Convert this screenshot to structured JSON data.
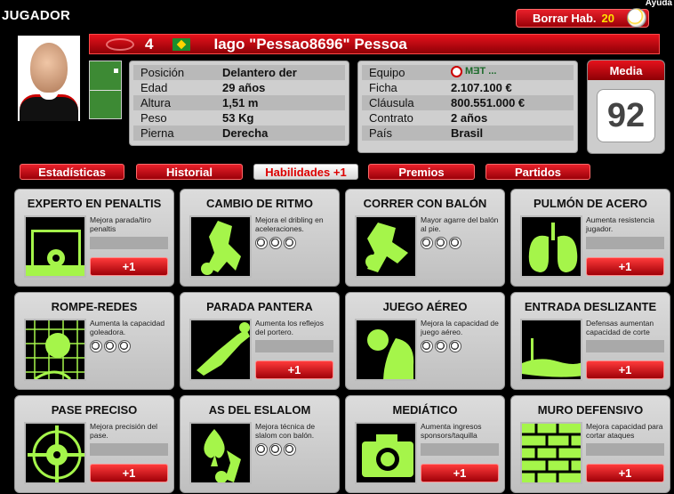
{
  "header": {
    "title": "JUGADOR",
    "help": "Ayuda",
    "borrar_label": "Borrar Hab.",
    "borrar_count": "20"
  },
  "player": {
    "number": "4",
    "name": "Iago \"Pessao8696\" Pessoa",
    "flag": "brazil-flag-icon"
  },
  "info_left": [
    {
      "label": "Posición",
      "value": "Delantero der"
    },
    {
      "label": "Edad",
      "value": "29 años"
    },
    {
      "label": "Altura",
      "value": "1,51 m"
    },
    {
      "label": "Peso",
      "value": "53 Kg"
    },
    {
      "label": "Pierna",
      "value": "Derecha"
    }
  ],
  "info_right": [
    {
      "label": "Equipo",
      "value": "MƎT ..."
    },
    {
      "label": "Ficha",
      "value": "2.107.100 €"
    },
    {
      "label": "Cláusula",
      "value": "800.551.000 €"
    },
    {
      "label": "Contrato",
      "value": "2 años"
    },
    {
      "label": "País",
      "value": "Brasil"
    }
  ],
  "media": {
    "label": "Media",
    "value": "92"
  },
  "tabs": [
    {
      "label": "Estadísticas",
      "active": false
    },
    {
      "label": "Historial",
      "active": false
    },
    {
      "label": "Habilidades +1",
      "active": true
    },
    {
      "label": "Premios",
      "active": false
    },
    {
      "label": "Partidos",
      "active": false
    }
  ],
  "skills": [
    {
      "title": "EXPERTO EN PENALTIS",
      "desc": "Mejora parada/tiro penaltis",
      "balls": 0,
      "button": "+1",
      "icon": "penalty-icon"
    },
    {
      "title": "CAMBIO DE RITMO",
      "desc": "Mejora el dribling en aceleraciones.",
      "balls": 3,
      "button": "",
      "icon": "dribble-icon"
    },
    {
      "title": "CORRER CON BALÓN",
      "desc": "Mayor agarre del balón al pie.",
      "balls": 3,
      "button": "",
      "icon": "run-ball-icon"
    },
    {
      "title": "PULMÓN DE ACERO",
      "desc": "Aumenta resistencia jugador.",
      "balls": 0,
      "button": "+1",
      "icon": "lungs-icon"
    },
    {
      "title": "ROMPE-REDES",
      "desc": "Aumenta la capacidad goleadora.",
      "balls": 3,
      "button": "",
      "icon": "net-ball-icon"
    },
    {
      "title": "PARADA PANTERA",
      "desc": "Aumenta los reflejos del portero.",
      "balls": 0,
      "button": "+1",
      "icon": "goalkeeper-icon"
    },
    {
      "title": "JUEGO AÉREO",
      "desc": "Mejora la capacidad de juego aéreo.",
      "balls": 3,
      "button": "",
      "icon": "header-icon"
    },
    {
      "title": "ENTRADA DESLIZANTE",
      "desc": "Defensas aumentan capacidad de corte",
      "balls": 0,
      "button": "+1",
      "icon": "slide-tackle-icon"
    },
    {
      "title": "PASE PRECISO",
      "desc": "Mejora precisión del pase.",
      "balls": 0,
      "button": "+1",
      "icon": "target-ball-icon"
    },
    {
      "title": "AS DEL ESLALOM",
      "desc": "Mejora técnica de slalom con balón.",
      "balls": 3,
      "button": "",
      "icon": "spade-icon"
    },
    {
      "title": "MEDIÁTICO",
      "desc": "Aumenta ingresos sponsors/taquilla",
      "balls": 0,
      "button": "+1",
      "icon": "camera-icon"
    },
    {
      "title": "MURO DEFENSIVO",
      "desc": "Mejora capacidad para cortar ataques",
      "balls": 0,
      "button": "+1",
      "icon": "brick-wall-icon"
    }
  ]
}
